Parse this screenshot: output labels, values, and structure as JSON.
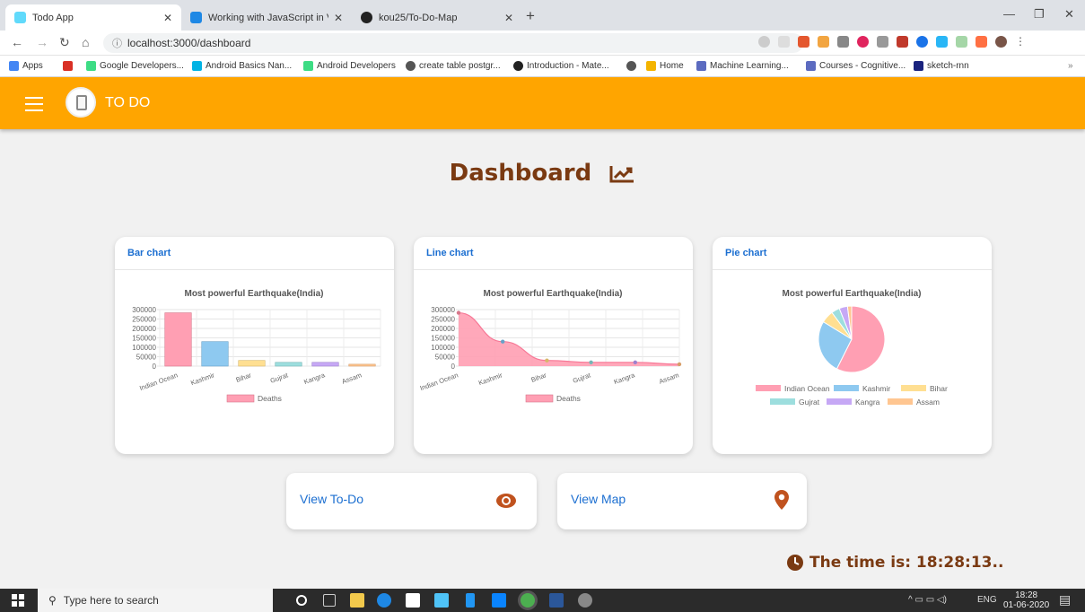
{
  "browser": {
    "tabs": [
      {
        "title": "Todo App",
        "icon": "react-icon",
        "color": "#61dafb"
      },
      {
        "title": "Working with JavaScript in Visual",
        "icon": "vscode-icon",
        "color": "#1e88e5"
      },
      {
        "title": "kou25/To-Do-Map",
        "icon": "github-icon",
        "color": "#222222"
      }
    ],
    "url": "localhost:3000/dashboard",
    "bookmarks": [
      {
        "label": "Apps"
      },
      {
        "label": ""
      },
      {
        "label": "Google Developers..."
      },
      {
        "label": "Android Basics Nan..."
      },
      {
        "label": "Android Developers"
      },
      {
        "label": "create table postgr..."
      },
      {
        "label": "Introduction - Mate..."
      },
      {
        "label": ""
      },
      {
        "label": "Home"
      },
      {
        "label": "Machine Learning..."
      },
      {
        "label": "Courses - Cognitive..."
      },
      {
        "label": "sketch-rnn"
      }
    ]
  },
  "app": {
    "title": "TO DO",
    "accent": "#ffa500",
    "heading": "Dashboard",
    "cards": [
      {
        "header": "Bar chart"
      },
      {
        "header": "Line chart"
      },
      {
        "header": "Pie chart"
      }
    ],
    "buttons": {
      "todo": "View To-Do",
      "map": "View Map"
    },
    "clock": "The time is: 18:28:13.."
  },
  "chart_data": [
    {
      "type": "bar",
      "title": "Most powerful Earthquake(India)",
      "categories": [
        "Indian Ocean",
        "Kashmir",
        "Bihar",
        "Gujrat",
        "Kangra",
        "Assam"
      ],
      "values": [
        283000,
        130000,
        30000,
        20000,
        20000,
        10000
      ],
      "legend": "Deaths",
      "yticks": [
        "300000",
        "250000",
        "200000",
        "150000",
        "100000",
        "50000",
        "0"
      ],
      "ylim": [
        0,
        300000
      ],
      "colors": [
        "#ff9fb3",
        "#8ec9f0",
        "#ffdf92",
        "#9ddede",
        "#c6a8f5",
        "#ffc691"
      ]
    },
    {
      "type": "line",
      "title": "Most powerful Earthquake(India)",
      "categories": [
        "Indian Ocean",
        "Kashmir",
        "Bihar",
        "Gujrat",
        "Kangra",
        "Assam"
      ],
      "values": [
        283000,
        130000,
        30000,
        20000,
        20000,
        10000
      ],
      "legend": "Deaths",
      "yticks": [
        "300000",
        "250000",
        "200000",
        "150000",
        "100000",
        "50000",
        "0"
      ],
      "ylim": [
        0,
        300000
      ],
      "colors": [
        "#ff9fb3",
        "#8ec9f0",
        "#ffdf92",
        "#9ddede",
        "#c6a8f5",
        "#ffc691"
      ]
    },
    {
      "type": "pie",
      "title": "Most powerful Earthquake(India)",
      "categories": [
        "Indian Ocean",
        "Kashmir",
        "Bihar",
        "Gujrat",
        "Kangra",
        "Assam"
      ],
      "values": [
        283000,
        130000,
        30000,
        20000,
        20000,
        10000
      ],
      "colors": [
        "#ff9fb3",
        "#8ec9f0",
        "#ffdf92",
        "#9ddede",
        "#c6a8f5",
        "#ffc691"
      ]
    }
  ],
  "taskbar": {
    "search_placeholder": "Type here to search",
    "lang": "ENG",
    "time": "18:28",
    "date": "01-06-2020"
  }
}
